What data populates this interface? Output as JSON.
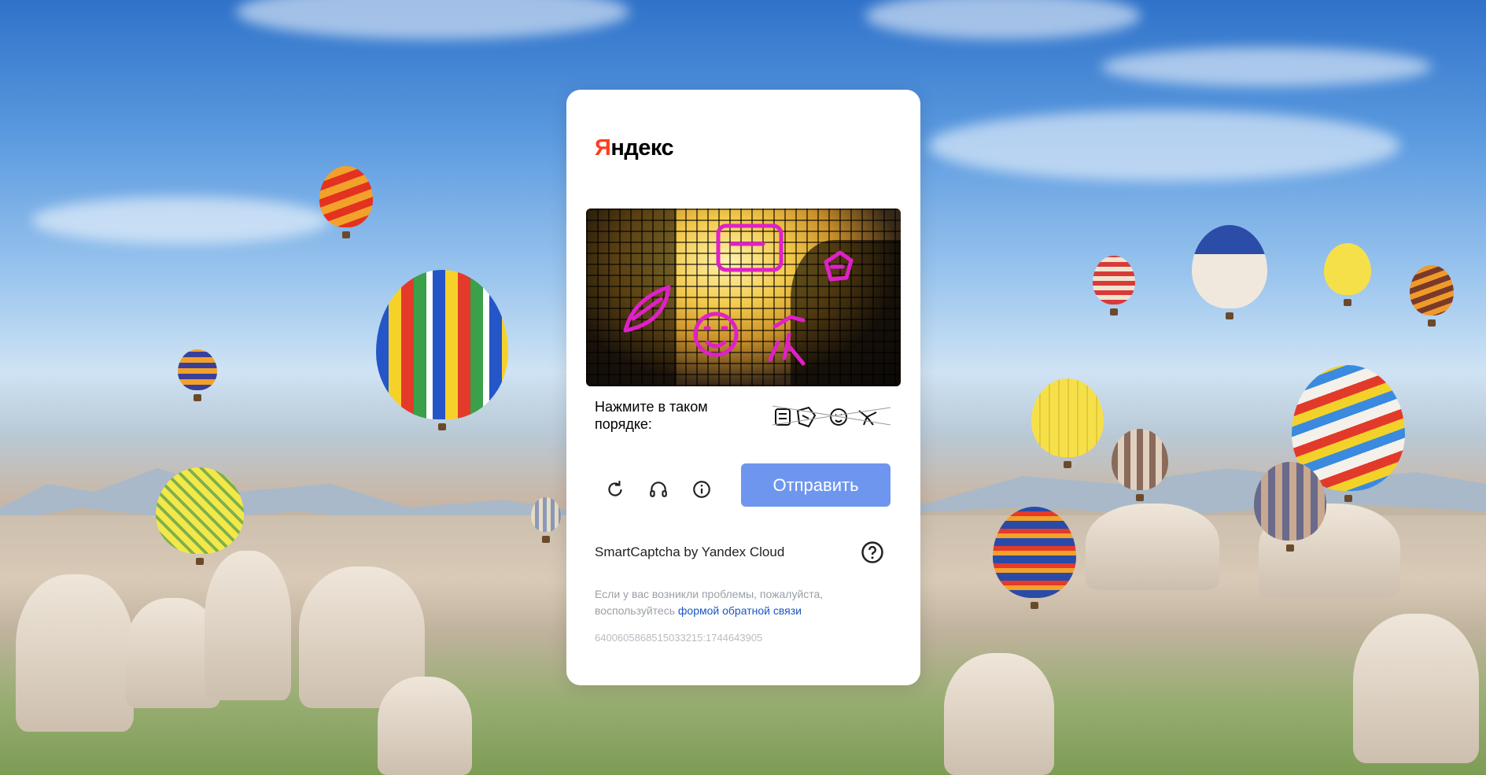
{
  "logo": {
    "first_letter": "Я",
    "rest": "ндекс"
  },
  "captcha": {
    "instruction": "Нажмите в таком порядке:",
    "order_icons": [
      "list-icon",
      "tag-icon",
      "smile-icon",
      "person-icon"
    ]
  },
  "toolbar": {
    "refresh_icon": "refresh-icon",
    "audio_icon": "headphones-icon",
    "info_icon": "info-icon",
    "submit_label": "Отправить"
  },
  "footer": {
    "brand": "SmartCaptcha by Yandex Cloud",
    "help_icon": "question-icon",
    "feedback_text": "Если у вас возникли проблемы, пожалуйста, воспользуйтесь",
    "feedback_link": "формой обратной связи",
    "request_id": "6400605868515033215:1744643905"
  },
  "colors": {
    "accent": "#fc3f1d",
    "submit_bg": "#6f96ef",
    "link": "#1a55c4",
    "captcha_glyph": "#e020c8"
  }
}
